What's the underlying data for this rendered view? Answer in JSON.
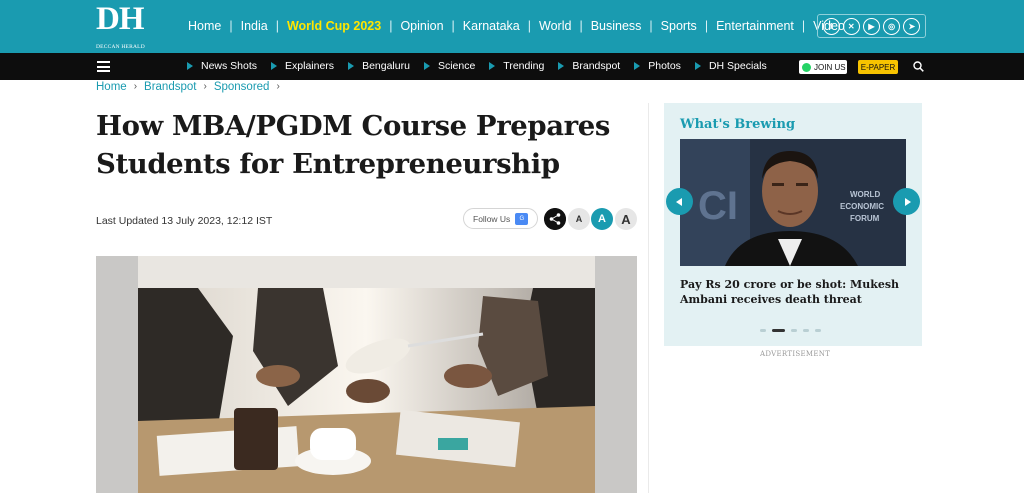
{
  "header": {
    "logo_text": "DH",
    "logo_subtext": "DECCAN HERALD",
    "nav": [
      {
        "label": "Home",
        "highlight": false
      },
      {
        "label": "India",
        "highlight": false
      },
      {
        "label": "World Cup 2023",
        "highlight": true
      },
      {
        "label": "Opinion",
        "highlight": false
      },
      {
        "label": "Karnataka",
        "highlight": false
      },
      {
        "label": "World",
        "highlight": false
      },
      {
        "label": "Business",
        "highlight": false
      },
      {
        "label": "Sports",
        "highlight": false
      },
      {
        "label": "Entertainment",
        "highlight": false
      },
      {
        "label": "Video",
        "highlight": false
      }
    ],
    "social_icons": [
      "facebook-icon",
      "x-twitter-icon",
      "youtube-icon",
      "instagram-icon",
      "telegram-icon"
    ],
    "brand_color": "#1a9bb0",
    "highlight_color": "#ffe600"
  },
  "subnav": {
    "items": [
      "News Shots",
      "Explainers",
      "Bengaluru",
      "Science",
      "Trending",
      "Brandspot",
      "Photos",
      "DH Specials"
    ],
    "join_us": "JOIN US",
    "epaper": "E-PAPER"
  },
  "breadcrumb": [
    "Home",
    "Brandspot",
    "Sponsored"
  ],
  "article": {
    "title": "How MBA/PGDM Course Prepares Students for Entrepreneurship",
    "last_updated": "Last Updated 13 July 2023, 12:12 IST",
    "follow_us": "Follow Us",
    "font_size_buttons": [
      "A",
      "A",
      "A"
    ]
  },
  "sidebar": {
    "heading": "What's Brewing",
    "story_caption": "Pay Rs 20 crore or be shot: Mukesh Ambani receives death threat",
    "carousel_total": 5,
    "carousel_active": 2,
    "advertisement_label": "ADVERTISEMENT"
  }
}
